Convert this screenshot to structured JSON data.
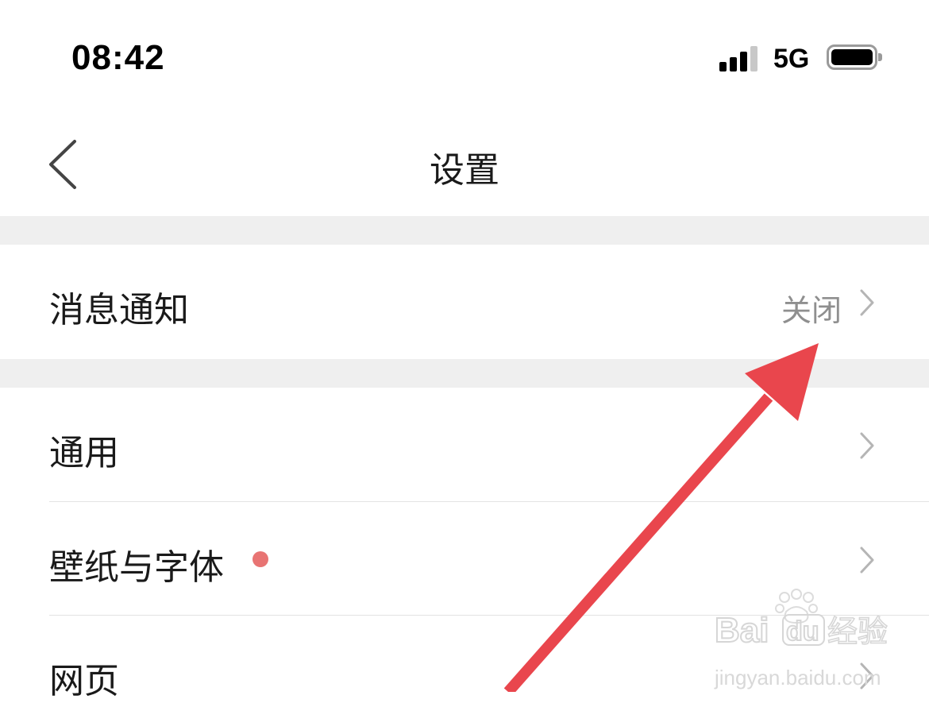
{
  "status_bar": {
    "time": "08:42",
    "network": "5G"
  },
  "nav": {
    "title": "设置",
    "back_icon": "chevron-left-icon"
  },
  "rows": [
    {
      "label": "消息通知",
      "value": "关闭",
      "icon": "chevron-right-icon"
    },
    {
      "label": "通用",
      "icon": "chevron-right-icon"
    },
    {
      "label": "壁纸与字体",
      "badge": "red-dot",
      "icon": "chevron-right-icon"
    },
    {
      "label": "网页",
      "icon": "chevron-right-icon"
    }
  ],
  "watermark": {
    "brand": "Bai du 经验",
    "url": "jingyan.baidu.com"
  },
  "colors": {
    "separator": "#efefef",
    "value_text": "#8f8f8f",
    "chevron": "#b5b5b5",
    "badge_red": "#e87473",
    "annotation_arrow": "#e9464d"
  }
}
